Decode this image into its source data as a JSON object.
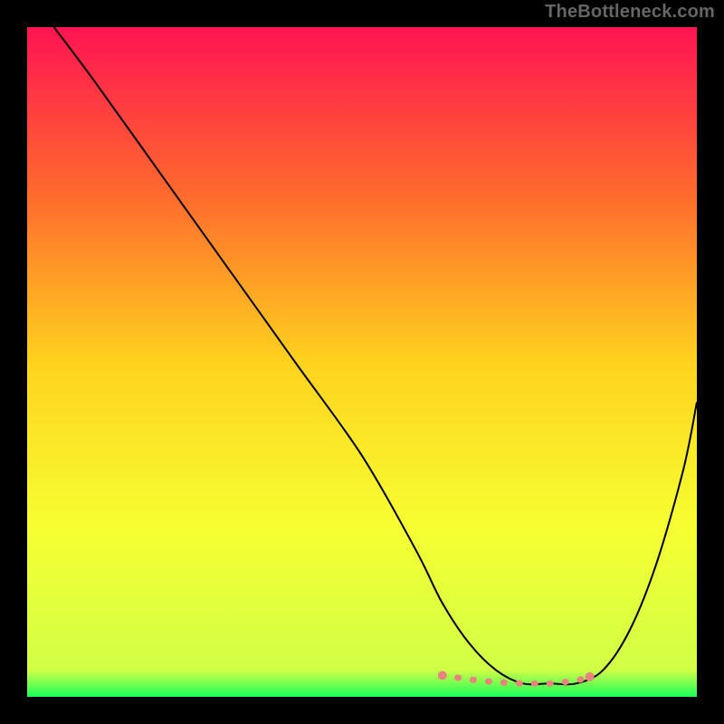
{
  "watermark": "TheBottleneck.com",
  "chart_data": {
    "type": "line",
    "title": "",
    "xlabel": "",
    "ylabel": "",
    "xlim": [
      0,
      100
    ],
    "ylim": [
      0,
      100
    ],
    "grid": false,
    "legend": false,
    "background_gradient": {
      "stops": [
        {
          "offset": 0.0,
          "color": "#ff1452"
        },
        {
          "offset": 0.25,
          "color": "#ff6a2d"
        },
        {
          "offset": 0.5,
          "color": "#ffd21e"
        },
        {
          "offset": 0.75,
          "color": "#f6ff32"
        },
        {
          "offset": 0.96,
          "color": "#d0ff46"
        },
        {
          "offset": 1.0,
          "color": "#1aff5a"
        }
      ]
    },
    "series": [
      {
        "name": "bottleneck-curve",
        "color": "#000000",
        "x": [
          4,
          10,
          20,
          30,
          40,
          50,
          58,
          62,
          66,
          70,
          74,
          78,
          82,
          86,
          90,
          94,
          98,
          100
        ],
        "y": [
          100,
          92,
          78,
          64,
          50,
          36,
          22,
          14,
          8,
          4,
          2,
          2,
          2,
          4,
          10,
          20,
          34,
          44
        ]
      }
    ],
    "highlight": {
      "name": "optimal-range",
      "color": "#e9837d",
      "x": [
        62,
        66,
        70,
        74,
        78,
        82,
        84
      ],
      "y": [
        3.2,
        2.6,
        2.2,
        2.0,
        2.0,
        2.4,
        3.0
      ]
    }
  }
}
